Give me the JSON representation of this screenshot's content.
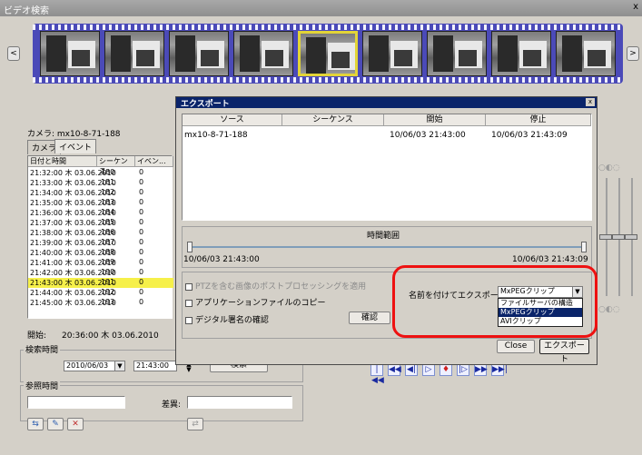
{
  "app": {
    "title": "ビデオ検索",
    "close": "x"
  },
  "filmstrip": {
    "prev": "<",
    "next": ">",
    "frame_count": 9,
    "selected_index": 4
  },
  "left_panel": {
    "camera_label": "カメラ: mx10-8-71-188",
    "tabs": [
      "カメラ",
      "イベント"
    ],
    "table": {
      "headers": [
        "日付と時間",
        "シーケンス",
        "イベン..."
      ],
      "rows": [
        [
          "21:32:00 木 03.06.2010",
          "180",
          "0"
        ],
        [
          "21:33:00 木 03.06.2010",
          "181",
          "0"
        ],
        [
          "21:34:00 木 03.06.2010",
          "182",
          "0"
        ],
        [
          "21:35:00 木 03.06.2010",
          "183",
          "0"
        ],
        [
          "21:36:00 木 03.06.2010",
          "184",
          "0"
        ],
        [
          "21:37:00 木 03.06.2010",
          "185",
          "0"
        ],
        [
          "21:38:00 木 03.06.2010",
          "186",
          "0"
        ],
        [
          "21:39:00 木 03.06.2010",
          "187",
          "0"
        ],
        [
          "21:40:00 木 03.06.2010",
          "188",
          "0"
        ],
        [
          "21:41:00 木 03.06.2010",
          "189",
          "0"
        ],
        [
          "21:42:00 木 03.06.2010",
          "190",
          "0"
        ],
        [
          "21:43:00 木 03.06.2010",
          "191",
          "0"
        ],
        [
          "21:44:00 木 03.06.2010",
          "192",
          "0"
        ],
        [
          "21:45:00 木 03.06.2010",
          "193",
          "0"
        ]
      ],
      "highlight_row": 11
    },
    "start_label": "開始:",
    "start_value": "20:36:00 木 03.06.2010",
    "search_time_group": "検索時間",
    "search_date": "2010/06/03",
    "search_time": "21:43:00",
    "search_button": "検索",
    "reference_group": "参照時間",
    "diff_label": "差異:"
  },
  "export_dialog": {
    "title": "エクスポート",
    "close": "x",
    "columns": [
      "ソース",
      "シーケンス",
      "開始",
      "停止"
    ],
    "rows": [
      {
        "source": "mx10-8-71-188",
        "sequence": "",
        "start": "10/06/03 21:43:00",
        "stop": "10/06/03 21:43:09"
      }
    ],
    "time_range_label": "時間範囲",
    "range_start": "10/06/03 21:43:00",
    "range_end": "10/06/03 21:43:09",
    "options": {
      "ptz_postprocess": "PTZを含む画像のポストプロセッシングを適用",
      "copy_app_files": "アプリケーションファイルのコピー",
      "verify_signature": "デジタル署名の確認"
    },
    "verify_button": "確認",
    "name_export_label": "名前を付けてエクスポート:",
    "format_selected": "MxPEGクリップ",
    "format_options": [
      "ファイルサーバの構造",
      "MxPEGクリップ",
      "AVIクリップ"
    ],
    "format_highlight": 1,
    "close_button": "Close",
    "export_button": "エクスポート"
  },
  "playback": {
    "buttons": [
      "|◀◀",
      "◀◀",
      "◀|",
      "▷",
      "♦",
      "|▷",
      "▶▶",
      "▶▶|"
    ]
  },
  "colors": {
    "highlight_yellow": "#f6f04a",
    "annotation_red": "#e11111",
    "film_blue": "#4b4ab8"
  }
}
